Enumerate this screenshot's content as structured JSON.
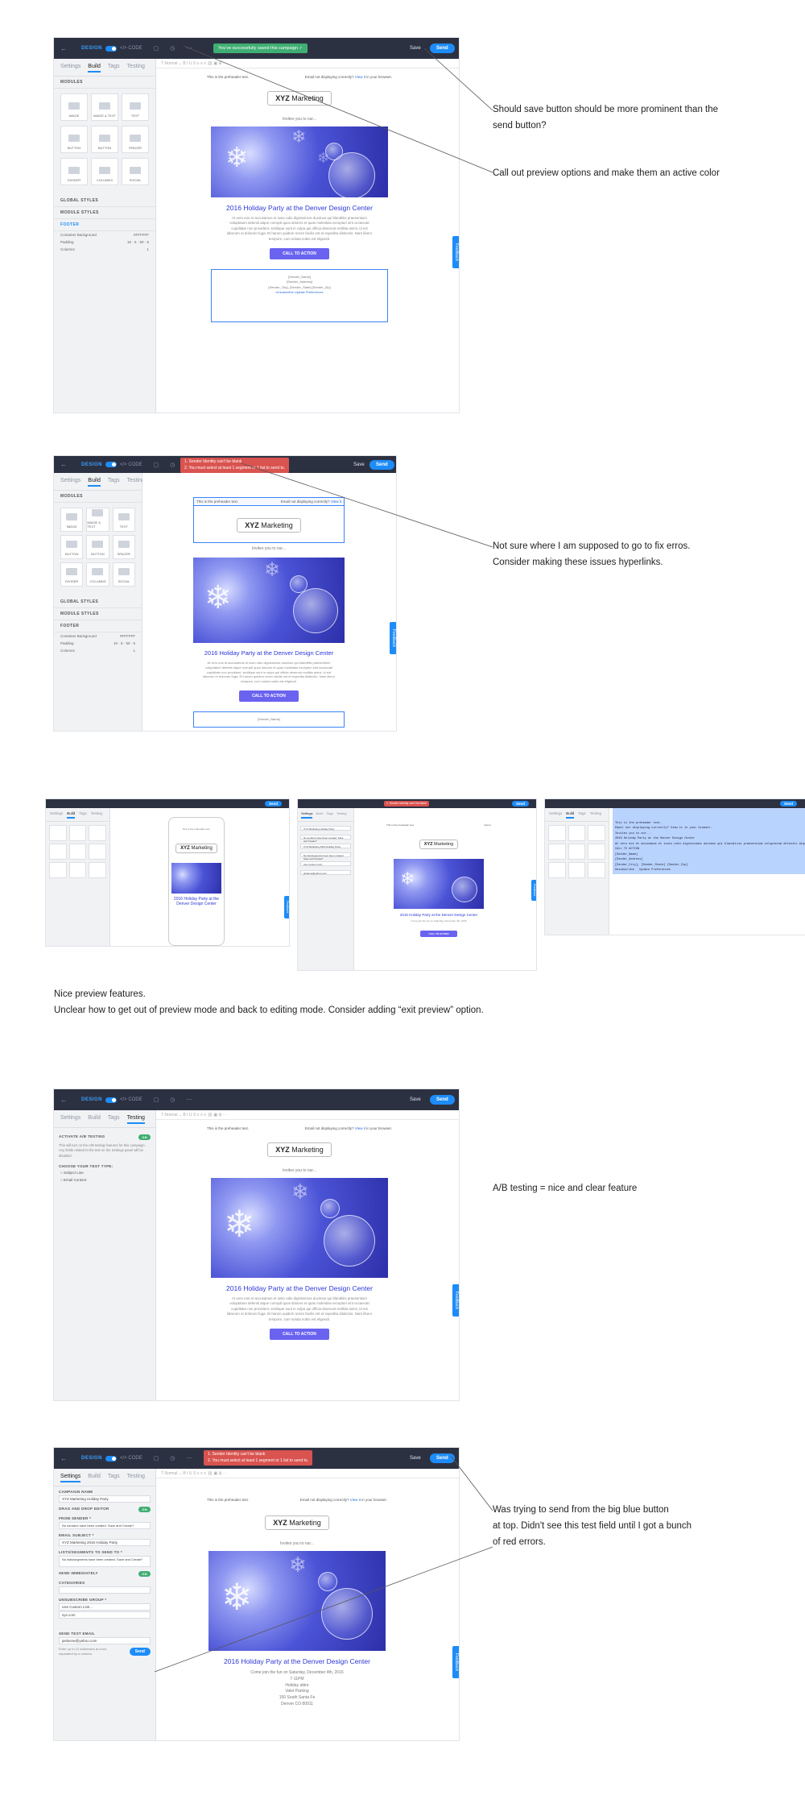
{
  "editor": {
    "back": "←",
    "mode_design": "DESIGN",
    "mode_code": "</> CODE",
    "toolbar_icons": "▢ ◷ ⋯",
    "save": "Save",
    "send": "Send",
    "toast_saved": "You've successfully saved this campaign ✓",
    "errors": [
      "1. Sender Identity can't be blank",
      "2. You must select at least 1 segment or 1 list to send to."
    ],
    "tabs": [
      "Settings",
      "Build",
      "Tags",
      "Testing"
    ],
    "canvas_toolbar": "T   Normal   ⌄    B  I  U  S    ≡  ≡  ≡    ⛓  ▣  ⊞  ⋯"
  },
  "modules": {
    "section": "MODULES",
    "tiles": [
      "IMAGE",
      "IMAGE & TEXT",
      "TEXT",
      "BUTTON",
      "BUTTON",
      "SPACER",
      "DIVIDER",
      "COLUMNS",
      "SOCIAL"
    ],
    "global_styles": "GLOBAL STYLES",
    "module_styles": "MODULE STYLES",
    "footer_label": "FOOTER",
    "container_background": "Container Background",
    "padding": "Padding",
    "columns": "Columns",
    "container_color": "#FFFFFF",
    "padding_values": [
      "10",
      "5",
      "50",
      "5"
    ],
    "columns_value": "1"
  },
  "email": {
    "preheader_left": "This is the preheader text.",
    "preheader_right_prefix": "Email not displaying correctly? ",
    "preheader_link": "View it",
    "preheader_right_suffix": " in your browser.",
    "logo_bold": "XYZ",
    "logo_rest": " Marketing",
    "invites": "Invites you to our...",
    "title": "2016 Holiday Party at the Denver Design Center",
    "body": "At vero eos et accusamus et iusto odio dignissimos ducimus qui blanditiis praesentium voluptatum deleniti atque corrupti quos dolores et quas molestias excepturi sint occaecati cupiditate non provident, similique sunt in culpa qui officia deserunt mollitia animi, id est laborum et dolorum fuga. Et harum quidem rerum facilis est et expedita distinctio. Nam libero tempore, cum soluta nobis est eligendi.",
    "cta": "CALL TO ACTION",
    "footer_lines": [
      "[Sender_Name]",
      "[Sender_Address]",
      "[Sender_City], [Sender_State] [Sender_Zip]"
    ],
    "footer_links": "Unsubscribe  Update Preferences",
    "settings_body": [
      "Come join the fun on Saturday, December 4th, 2016",
      "7-11PM",
      "Holiday attire",
      "Valet Parking",
      "",
      "150 South Santa Fe",
      "Denver CO 80011"
    ],
    "feedback": "Feedback"
  },
  "testing_panel": {
    "activate": "ACTIVATE A/B TESTING",
    "toggle": "ON",
    "desc": "This will turn on the A/B testing features for this campaign. Any fields related to the test on the Settings panel will be disabled.",
    "choose": "CHOOSE YOUR TEST TYPE:",
    "options": [
      "Subject Line",
      "Email Content"
    ]
  },
  "settings_panel": {
    "fields": [
      {
        "label": "CAMPAIGN NAME",
        "value": "XYZ Marketing Holiday Party"
      },
      {
        "label": "DRAG AND DROP EDITOR",
        "value": "ON"
      },
      {
        "label": "FROM SENDER *",
        "value": "No senders have been created. Save and Create?"
      },
      {
        "label": "EMAIL SUBJECT *",
        "value": "XYZ Marketing 2016 Holiday Party"
      },
      {
        "label": "LISTS/SEGMENTS TO SEND TO *",
        "value": "No lists/segments have been created. Save and Create?"
      },
      {
        "label": "SEND IMMEDIATELY",
        "value": "ON"
      },
      {
        "label": "CATEGORIES",
        "value": ""
      },
      {
        "label": "UNSUBSCRIBE GROUP *",
        "value": "Use Custom Link..."
      },
      {
        "label": "",
        "value": "sys.com"
      },
      {
        "label": "SEND TEST EMAIL",
        "value": "janlarow@yahoo.com"
      }
    ],
    "hint": "Enter up to 10 addresses at once, separated by a comma.",
    "send_button": "Send"
  },
  "code_lines": [
    "This is the preheader text.",
    "Email not displaying correctly? View it in your browser.",
    "Invites you to our...",
    "2016 Holiday Party at the Denver Design Center",
    "At vero eos et accusamus et iusto odio dignissimos ducimus qui blanditiis praesentium voluptatum deleniti atque corrupti quos",
    "CALL TO ACTION",
    "[Sender_Name]",
    "[Sender_Address]",
    "[Sender_City], [Sender_State] [Sender_Zip]",
    "Unsubscribe   Update Preferences"
  ],
  "notes": {
    "save_prominent": "Should save button should be more prominent than the\nsend button?",
    "preview_options": "Call out preview options and make them an active color",
    "errors_hyperlinks": "Not sure where I am supposed to go to fix erros.\nConsider making these issues hyperlinks.",
    "preview_features": "Nice preview features.\nUnclear how to get out of preview mode and back to editing mode. Consider adding “exit preview” option.",
    "ab_testing": "A/B testing = nice and clear feature",
    "send_errors": "Was trying to send from the big blue button\nat top. Didn't see this test field until I got a bunch\nof red errors."
  },
  "colors": {
    "accent": "#1d8cf8",
    "topbar": "#2c3142",
    "success": "#3fae73",
    "error": "#d9534f",
    "cta": "#6a63f0",
    "title": "#2c37d4"
  }
}
